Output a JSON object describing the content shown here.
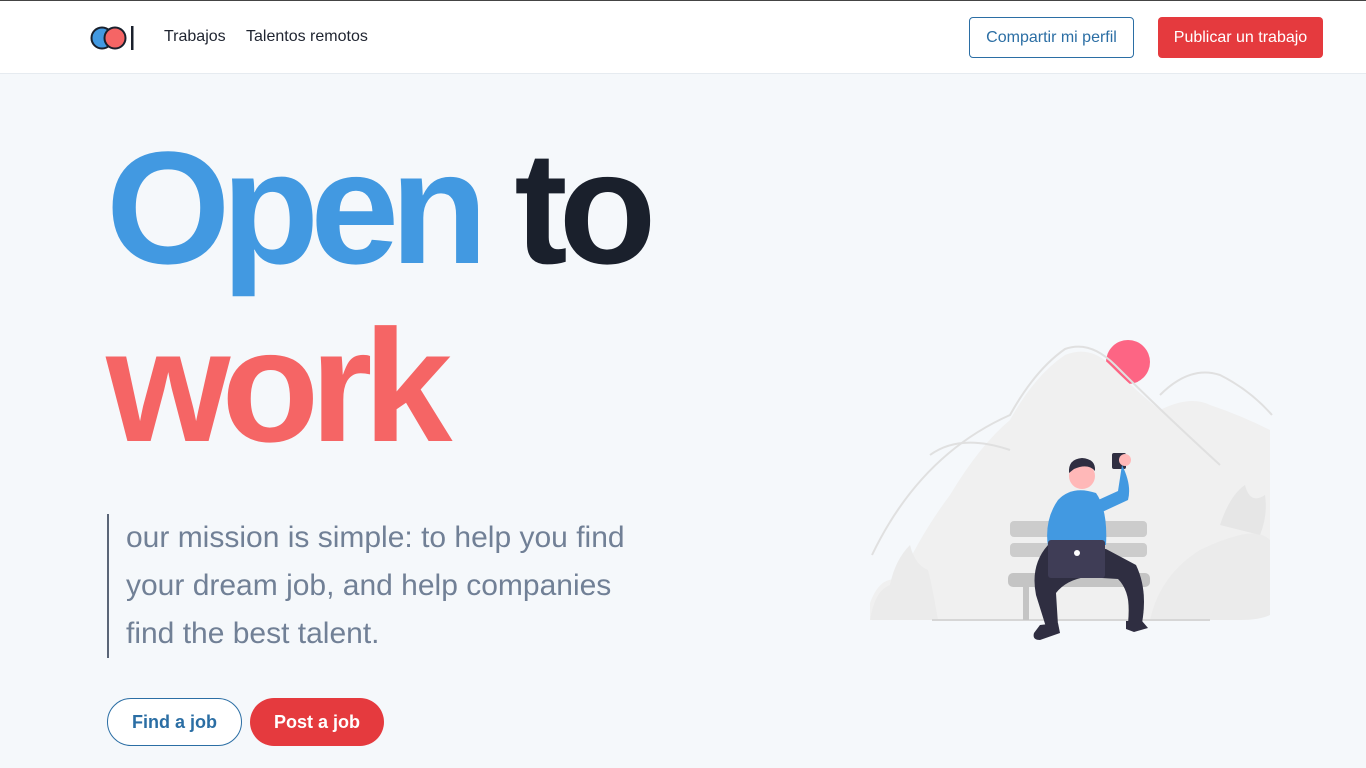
{
  "header": {
    "nav": [
      "Trabajos",
      "Talentos remotos"
    ],
    "share_profile_label": "Compartir mi perfil",
    "post_job_label": "Publicar un trabajo"
  },
  "hero": {
    "headline_word_1": "Open",
    "headline_word_2": "to",
    "headline_word_3": "work",
    "mission_text": "our mission is simple: to help you find your dream job, and help companies find the best talent.",
    "find_job_label": "Find a job",
    "post_job_label": "Post a job"
  },
  "colors": {
    "brand_blue": "#4299e1",
    "brand_red": "#e53a3e",
    "headline_red": "#f56565",
    "outline_blue": "#2b6ea4",
    "dark_text": "#1a202c",
    "muted_text": "#718096",
    "page_background": "#f5f8fb"
  },
  "icons": {
    "logo": "two-circles-logo",
    "illustration": "person-on-bench-with-laptop"
  }
}
